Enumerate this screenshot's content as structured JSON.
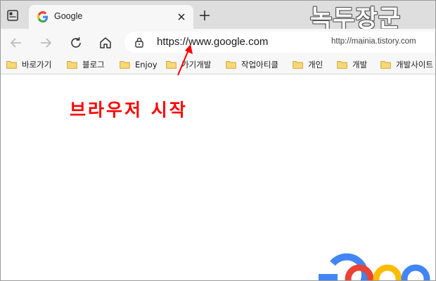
{
  "tab": {
    "title": "Google",
    "close_icon": "close-icon",
    "favicon": "google-g-icon"
  },
  "toolbar": {
    "url": "https://www.google.com"
  },
  "bookmarks": [
    {
      "label": "바로가기"
    },
    {
      "label": "블로그"
    },
    {
      "label": "Enjoy"
    },
    {
      "label": "가기개발"
    },
    {
      "label": "작업아티클"
    },
    {
      "label": "개인"
    },
    {
      "label": "개발"
    },
    {
      "label": "개발사이트"
    }
  ],
  "watermark": {
    "title": "녹두장군",
    "url": "http://mainia.tistory.com"
  },
  "annotation": {
    "text": "브라우저 시작",
    "color": "#ff0000"
  },
  "colors": {
    "google_blue": "#4285f4",
    "google_red": "#ea4335",
    "google_yellow": "#fbbc05",
    "google_green": "#34a853"
  }
}
